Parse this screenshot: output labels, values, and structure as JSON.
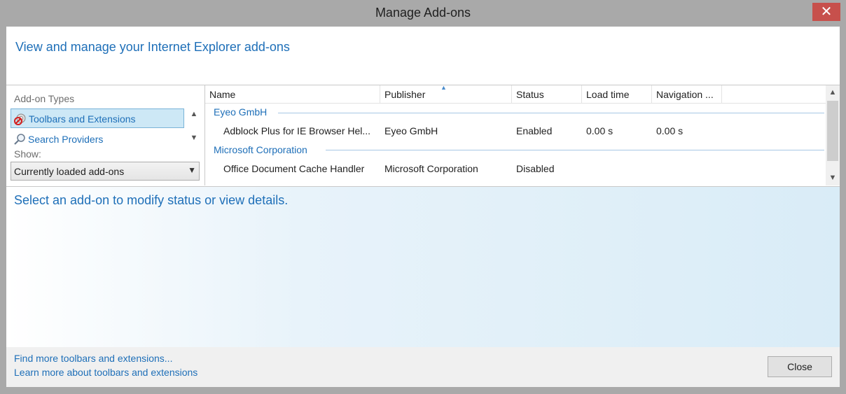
{
  "window": {
    "title": "Manage Add-ons",
    "close_glyph": "✕"
  },
  "header": {
    "title": "View and manage your Internet Explorer add-ons"
  },
  "left_pane": {
    "addon_types_label": "Add-on Types",
    "types": [
      {
        "label": "Toolbars and Extensions",
        "icon": "toolbar-extension-icon",
        "selected": true
      },
      {
        "label": "Search Providers",
        "icon": "search-provider-icon",
        "selected": false
      }
    ],
    "show_label": "Show:",
    "show_value": "Currently loaded add-ons"
  },
  "table": {
    "columns": [
      "Name",
      "Publisher",
      "Status",
      "Load time",
      "Navigation ..."
    ],
    "groups": [
      {
        "name": "Eyeo GmbH",
        "rows": [
          {
            "name": "Adblock Plus for IE Browser Hel...",
            "publisher": "Eyeo GmbH",
            "status": "Enabled",
            "load_time": "0.00 s",
            "navigation": "0.00 s"
          }
        ]
      },
      {
        "name": "Microsoft Corporation",
        "rows": [
          {
            "name": "Office Document Cache Handler",
            "publisher": "Microsoft Corporation",
            "status": "Disabled",
            "load_time": "",
            "navigation": ""
          }
        ]
      }
    ]
  },
  "details": {
    "prompt": "Select an add-on to modify status or view details."
  },
  "footer": {
    "link_find": "Find more toolbars and extensions...",
    "link_learn": "Learn more about toolbars and extensions",
    "close_label": "Close"
  },
  "colors": {
    "accent": "#1e6fb8",
    "selected_bg": "#cde8f6",
    "title_close_bg": "#c7504c"
  }
}
